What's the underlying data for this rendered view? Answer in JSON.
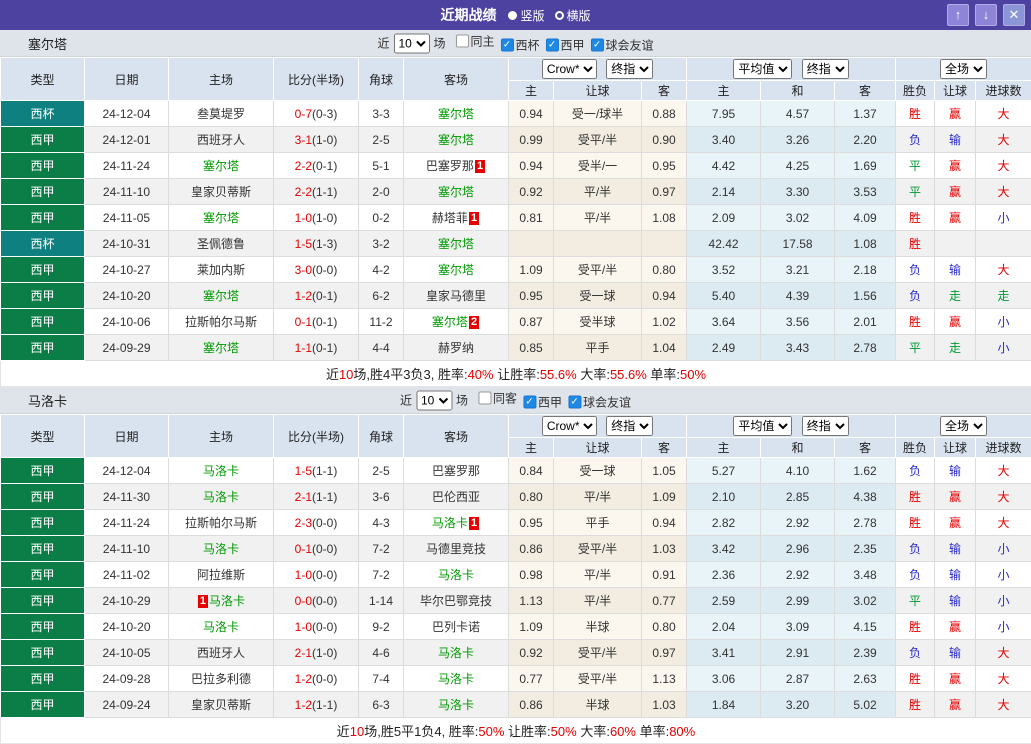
{
  "titlebar": {
    "title": "近期战绩",
    "radios": [
      {
        "label": "竖版",
        "selected": true
      },
      {
        "label": "横版",
        "selected": false
      }
    ],
    "buttons": {
      "up": "↑",
      "down": "↓",
      "close": "✕"
    }
  },
  "filters": {
    "near": "近",
    "count": "10",
    "games": "场"
  },
  "table_header": {
    "left": [
      "类型",
      "日期",
      "主场",
      "比分(半场)",
      "角球",
      "客场"
    ],
    "right": [
      "主",
      "让球",
      "客",
      "主",
      "和",
      "客",
      "胜负",
      "让球",
      "进球数"
    ],
    "selects": {
      "bookmaker": "Crow*",
      "asia_final": "终指",
      "euro_avg": "平均值",
      "euro_final": "终指",
      "scope": "全场"
    }
  },
  "type_colors": {
    "西甲": "#0b7d46",
    "西杯": "#0e8080"
  },
  "result_colors": {
    "胜": "#e60000",
    "赢": "#e60000",
    "大": "#e60000",
    "负": "#2929cc",
    "输": "#2929cc",
    "小": "#2929cc",
    "平": "#009933",
    "走": "#009933"
  },
  "sections": [
    {
      "team": "塞尔塔",
      "checkboxes": [
        {
          "label": "同主",
          "checked": false
        },
        {
          "label": "西杯",
          "checked": true
        },
        {
          "label": "西甲",
          "checked": true
        },
        {
          "label": "球会友谊",
          "checked": true
        }
      ],
      "rows": [
        {
          "type": "西杯",
          "date": "24-12-04",
          "home": {
            "name": "叁莫堤罗",
            "green": false
          },
          "score": "0-7",
          "half": "(0-3)",
          "corners": "3-3",
          "away": {
            "name": "塞尔塔",
            "green": true
          },
          "asia": [
            "0.94",
            "受一/球半",
            "0.88"
          ],
          "euro": [
            "7.95",
            "4.57",
            "1.37"
          ],
          "results": [
            "胜",
            "赢",
            "大"
          ]
        },
        {
          "type": "西甲",
          "date": "24-12-01",
          "home": {
            "name": "西班牙人",
            "green": false
          },
          "score": "3-1",
          "half": "(1-0)",
          "corners": "2-5",
          "away": {
            "name": "塞尔塔",
            "green": true
          },
          "asia": [
            "0.99",
            "受平/半",
            "0.90"
          ],
          "euro": [
            "3.40",
            "3.26",
            "2.20"
          ],
          "results": [
            "负",
            "输",
            "大"
          ]
        },
        {
          "type": "西甲",
          "date": "24-11-24",
          "home": {
            "name": "塞尔塔",
            "green": true
          },
          "score": "2-2",
          "half": "(0-1)",
          "corners": "5-1",
          "away": {
            "name": "巴塞罗那",
            "green": false,
            "badge": "1"
          },
          "asia": [
            "0.94",
            "受半/一",
            "0.95"
          ],
          "euro": [
            "4.42",
            "4.25",
            "1.69"
          ],
          "results": [
            "平",
            "赢",
            "大"
          ]
        },
        {
          "type": "西甲",
          "date": "24-11-10",
          "home": {
            "name": "皇家贝蒂斯",
            "green": false
          },
          "score": "2-2",
          "half": "(1-1)",
          "corners": "2-0",
          "away": {
            "name": "塞尔塔",
            "green": true
          },
          "asia": [
            "0.92",
            "平/半",
            "0.97"
          ],
          "euro": [
            "2.14",
            "3.30",
            "3.53"
          ],
          "results": [
            "平",
            "赢",
            "大"
          ]
        },
        {
          "type": "西甲",
          "date": "24-11-05",
          "home": {
            "name": "塞尔塔",
            "green": true
          },
          "score": "1-0",
          "half": "(1-0)",
          "corners": "0-2",
          "away": {
            "name": "赫塔菲",
            "green": false,
            "badge": "1"
          },
          "asia": [
            "0.81",
            "平/半",
            "1.08"
          ],
          "euro": [
            "2.09",
            "3.02",
            "4.09"
          ],
          "results": [
            "胜",
            "赢",
            "小"
          ]
        },
        {
          "type": "西杯",
          "date": "24-10-31",
          "home": {
            "name": "圣佩德鲁",
            "green": false
          },
          "score": "1-5",
          "half": "(1-3)",
          "corners": "3-2",
          "away": {
            "name": "塞尔塔",
            "green": true
          },
          "asia": [
            "",
            "",
            ""
          ],
          "euro": [
            "42.42",
            "17.58",
            "1.08"
          ],
          "results": [
            "胜",
            "",
            ""
          ]
        },
        {
          "type": "西甲",
          "date": "24-10-27",
          "home": {
            "name": "莱加内斯",
            "green": false
          },
          "score": "3-0",
          "half": "(0-0)",
          "corners": "4-2",
          "away": {
            "name": "塞尔塔",
            "green": true
          },
          "asia": [
            "1.09",
            "受平/半",
            "0.80"
          ],
          "euro": [
            "3.52",
            "3.21",
            "2.18"
          ],
          "results": [
            "负",
            "输",
            "大"
          ]
        },
        {
          "type": "西甲",
          "date": "24-10-20",
          "home": {
            "name": "塞尔塔",
            "green": true
          },
          "score": "1-2",
          "half": "(0-1)",
          "corners": "6-2",
          "away": {
            "name": "皇家马德里",
            "green": false
          },
          "asia": [
            "0.95",
            "受一球",
            "0.94"
          ],
          "euro": [
            "5.40",
            "4.39",
            "1.56"
          ],
          "results": [
            "负",
            "走",
            "走"
          ]
        },
        {
          "type": "西甲",
          "date": "24-10-06",
          "home": {
            "name": "拉斯帕尔马斯",
            "green": false
          },
          "score": "0-1",
          "half": "(0-1)",
          "corners": "11-2",
          "away": {
            "name": "塞尔塔",
            "green": true,
            "badge": "2"
          },
          "asia": [
            "0.87",
            "受半球",
            "1.02"
          ],
          "euro": [
            "3.64",
            "3.56",
            "2.01"
          ],
          "results": [
            "胜",
            "赢",
            "小"
          ]
        },
        {
          "type": "西甲",
          "date": "24-09-29",
          "home": {
            "name": "塞尔塔",
            "green": true
          },
          "score": "1-1",
          "half": "(0-1)",
          "corners": "4-4",
          "away": {
            "name": "赫罗纳",
            "green": false
          },
          "asia": [
            "0.85",
            "平手",
            "1.04"
          ],
          "euro": [
            "2.49",
            "3.43",
            "2.78"
          ],
          "results": [
            "平",
            "走",
            "小"
          ]
        }
      ],
      "summary": [
        [
          "近",
          "n"
        ],
        [
          "10",
          "r"
        ],
        [
          "场,胜4平3负3, 胜率:",
          "n"
        ],
        [
          "40%",
          "r"
        ],
        [
          " 让胜率:",
          "n"
        ],
        [
          "55.6%",
          "r"
        ],
        [
          " 大率:",
          "n"
        ],
        [
          "55.6%",
          "r"
        ],
        [
          " 单率:",
          "n"
        ],
        [
          "50%",
          "r"
        ]
      ]
    },
    {
      "team": "马洛卡",
      "checkboxes": [
        {
          "label": "同客",
          "checked": false
        },
        {
          "label": "西甲",
          "checked": true
        },
        {
          "label": "球会友谊",
          "checked": true
        }
      ],
      "rows": [
        {
          "type": "西甲",
          "date": "24-12-04",
          "home": {
            "name": "马洛卡",
            "green": true
          },
          "score": "1-5",
          "half": "(1-1)",
          "corners": "2-5",
          "away": {
            "name": "巴塞罗那",
            "green": false
          },
          "asia": [
            "0.84",
            "受一球",
            "1.05"
          ],
          "euro": [
            "5.27",
            "4.10",
            "1.62"
          ],
          "results": [
            "负",
            "输",
            "大"
          ]
        },
        {
          "type": "西甲",
          "date": "24-11-30",
          "home": {
            "name": "马洛卡",
            "green": true
          },
          "score": "2-1",
          "half": "(1-1)",
          "corners": "3-6",
          "away": {
            "name": "巴伦西亚",
            "green": false
          },
          "asia": [
            "0.80",
            "平/半",
            "1.09"
          ],
          "euro": [
            "2.10",
            "2.85",
            "4.38"
          ],
          "results": [
            "胜",
            "赢",
            "大"
          ]
        },
        {
          "type": "西甲",
          "date": "24-11-24",
          "home": {
            "name": "拉斯帕尔马斯",
            "green": false
          },
          "score": "2-3",
          "half": "(0-0)",
          "corners": "4-3",
          "away": {
            "name": "马洛卡",
            "green": true,
            "badge": "1"
          },
          "asia": [
            "0.95",
            "平手",
            "0.94"
          ],
          "euro": [
            "2.82",
            "2.92",
            "2.78"
          ],
          "results": [
            "胜",
            "赢",
            "大"
          ]
        },
        {
          "type": "西甲",
          "date": "24-11-10",
          "home": {
            "name": "马洛卡",
            "green": true
          },
          "score": "0-1",
          "half": "(0-0)",
          "corners": "7-2",
          "away": {
            "name": "马德里竞技",
            "green": false
          },
          "asia": [
            "0.86",
            "受平/半",
            "1.03"
          ],
          "euro": [
            "3.42",
            "2.96",
            "2.35"
          ],
          "results": [
            "负",
            "输",
            "小"
          ]
        },
        {
          "type": "西甲",
          "date": "24-11-02",
          "home": {
            "name": "阿拉维斯",
            "green": false
          },
          "score": "1-0",
          "half": "(0-0)",
          "corners": "7-2",
          "away": {
            "name": "马洛卡",
            "green": true
          },
          "asia": [
            "0.98",
            "平/半",
            "0.91"
          ],
          "euro": [
            "2.36",
            "2.92",
            "3.48"
          ],
          "results": [
            "负",
            "输",
            "小"
          ]
        },
        {
          "type": "西甲",
          "date": "24-10-29",
          "home": {
            "name": "马洛卡",
            "green": true,
            "badge": "1",
            "badge_first": true
          },
          "score": "0-0",
          "half": "(0-0)",
          "corners": "1-14",
          "away": {
            "name": "毕尔巴鄂竞技",
            "green": false
          },
          "asia": [
            "1.13",
            "平/半",
            "0.77"
          ],
          "euro": [
            "2.59",
            "2.99",
            "3.02"
          ],
          "results": [
            "平",
            "输",
            "小"
          ]
        },
        {
          "type": "西甲",
          "date": "24-10-20",
          "home": {
            "name": "马洛卡",
            "green": true
          },
          "score": "1-0",
          "half": "(0-0)",
          "corners": "9-2",
          "away": {
            "name": "巴列卡诺",
            "green": false
          },
          "asia": [
            "1.09",
            "半球",
            "0.80"
          ],
          "euro": [
            "2.04",
            "3.09",
            "4.15"
          ],
          "results": [
            "胜",
            "赢",
            "小"
          ]
        },
        {
          "type": "西甲",
          "date": "24-10-05",
          "home": {
            "name": "西班牙人",
            "green": false
          },
          "score": "2-1",
          "half": "(1-0)",
          "corners": "4-6",
          "away": {
            "name": "马洛卡",
            "green": true
          },
          "asia": [
            "0.92",
            "受平/半",
            "0.97"
          ],
          "euro": [
            "3.41",
            "2.91",
            "2.39"
          ],
          "results": [
            "负",
            "输",
            "大"
          ]
        },
        {
          "type": "西甲",
          "date": "24-09-28",
          "home": {
            "name": "巴拉多利德",
            "green": false
          },
          "score": "1-2",
          "half": "(0-0)",
          "corners": "7-4",
          "away": {
            "name": "马洛卡",
            "green": true
          },
          "asia": [
            "0.77",
            "受平/半",
            "1.13"
          ],
          "euro": [
            "3.06",
            "2.87",
            "2.63"
          ],
          "results": [
            "胜",
            "赢",
            "大"
          ]
        },
        {
          "type": "西甲",
          "date": "24-09-24",
          "home": {
            "name": "皇家贝蒂斯",
            "green": false
          },
          "score": "1-2",
          "half": "(1-1)",
          "corners": "6-3",
          "away": {
            "name": "马洛卡",
            "green": true
          },
          "asia": [
            "0.86",
            "半球",
            "1.03"
          ],
          "euro": [
            "1.84",
            "3.20",
            "5.02"
          ],
          "results": [
            "胜",
            "赢",
            "大"
          ]
        }
      ],
      "summary": [
        [
          "近",
          "n"
        ],
        [
          "10",
          "r"
        ],
        [
          "场,胜5平1负4, 胜率:",
          "n"
        ],
        [
          "50%",
          "r"
        ],
        [
          " 让胜率:",
          "n"
        ],
        [
          "50%",
          "r"
        ],
        [
          " 大率:",
          "n"
        ],
        [
          "60%",
          "r"
        ],
        [
          " 单率:",
          "n"
        ],
        [
          "80%",
          "r"
        ]
      ]
    }
  ]
}
